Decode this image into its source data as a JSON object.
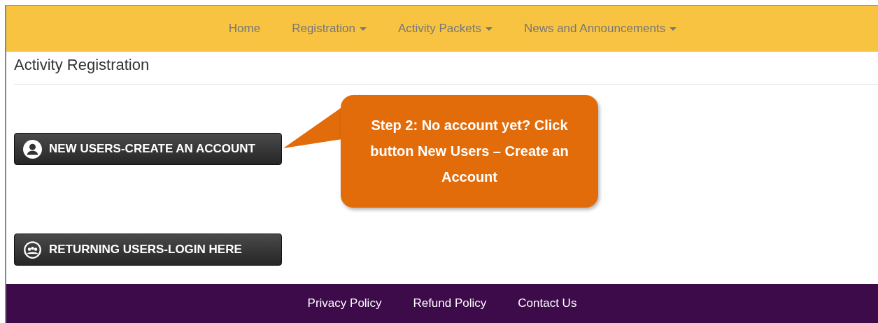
{
  "nav": {
    "items": [
      {
        "label": "Home",
        "dropdown": false
      },
      {
        "label": "Registration",
        "dropdown": true
      },
      {
        "label": "Activity Packets",
        "dropdown": true
      },
      {
        "label": "News and Announcements",
        "dropdown": true
      }
    ]
  },
  "page_title": "Activity Registration",
  "buttons": [
    {
      "label": "NEW USERS-CREATE AN ACCOUNT",
      "kind": "new-user"
    },
    {
      "label": "RETURNING USERS-LOGIN HERE",
      "kind": "returning"
    }
  ],
  "callout": {
    "text": "Step 2: No account yet? Click button New Users – Create an Account"
  },
  "footer": {
    "links": [
      "Privacy Policy",
      "Refund Policy",
      "Contact Us"
    ]
  }
}
